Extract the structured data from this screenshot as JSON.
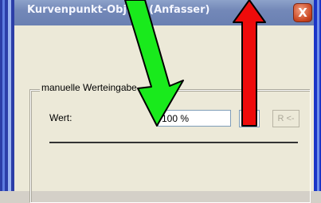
{
  "window": {
    "title": "Kurvenpunkt-Objekt (Anfasser)",
    "close_glyph": "X"
  },
  "group": {
    "legend": "manuelle Werteingabe",
    "wert_label": "Wert:",
    "wert_value": "100 %",
    "r_button_label": "R <-"
  },
  "annotations": {
    "green_arrow_color": "#19ea1c",
    "red_arrow_color": "#ee0b0b"
  }
}
